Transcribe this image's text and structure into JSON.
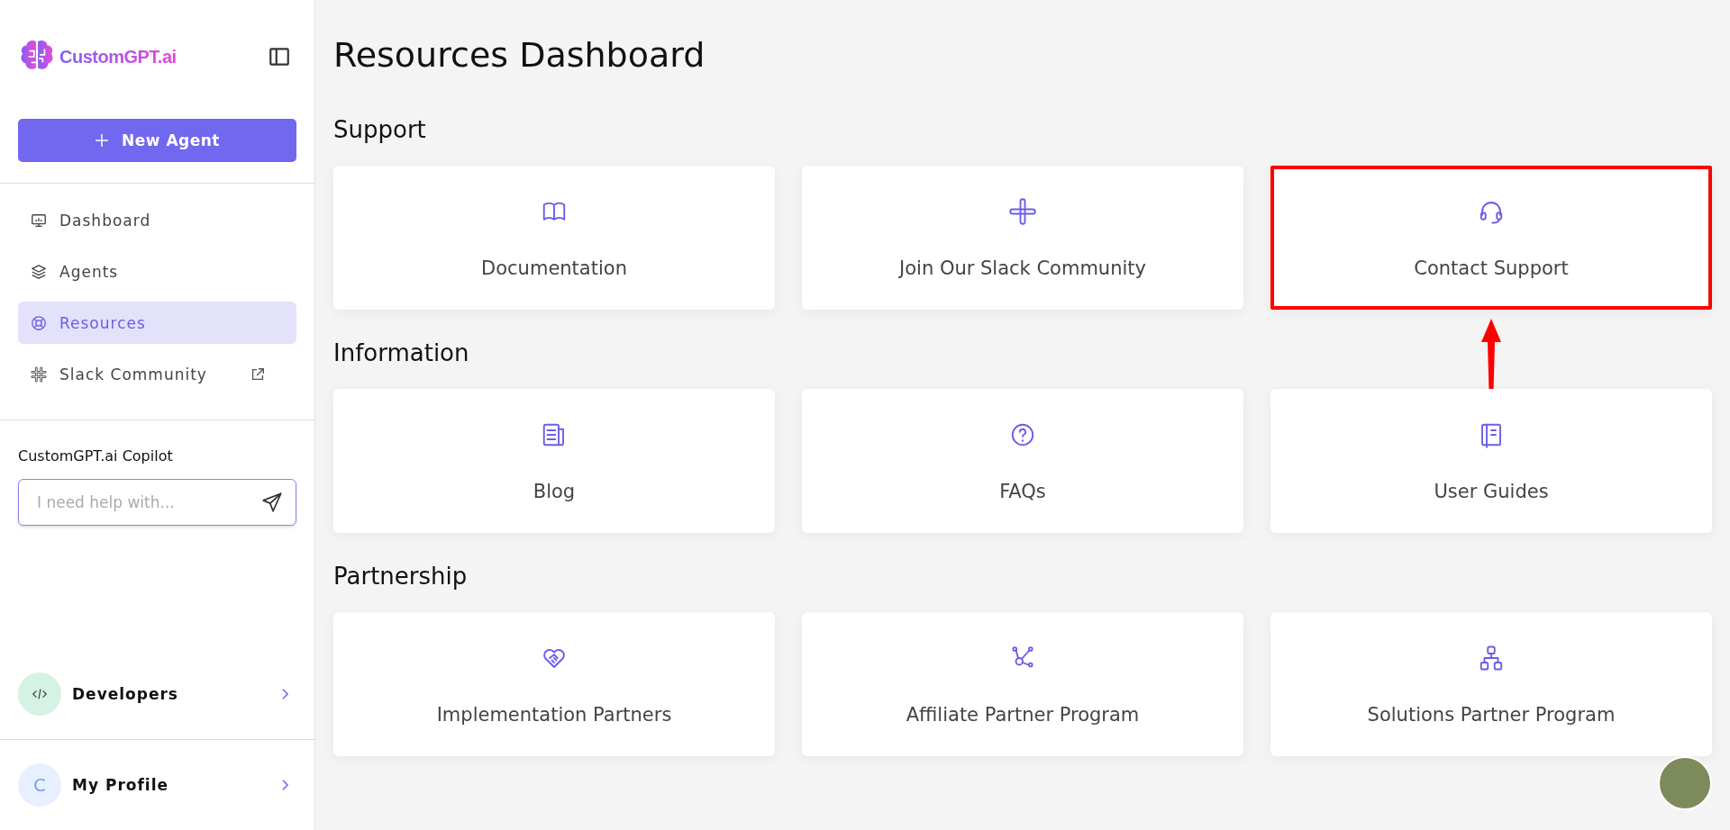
{
  "sidebar": {
    "logo": "CustomGPT.ai",
    "new_button": "New Agent",
    "nav": [
      {
        "label": "Dashboard",
        "selected": false,
        "external": false
      },
      {
        "label": "Agents",
        "selected": false,
        "external": false
      },
      {
        "label": "Resources",
        "selected": true,
        "external": false
      },
      {
        "label": "Slack Community",
        "selected": false,
        "external": true
      }
    ],
    "copilot": {
      "title": "CustomGPT.ai Copilot",
      "placeholder": "I need help with..."
    },
    "footer": [
      {
        "kind": "developers",
        "label": "Developers"
      },
      {
        "kind": "profile",
        "label": "My Profile",
        "initial": "C"
      }
    ]
  },
  "main": {
    "title": "Resources Dashboard",
    "sections": [
      {
        "title": "Support",
        "cards": [
          {
            "label": "Documentation",
            "highlighted": false
          },
          {
            "label": "Join Our Slack Community",
            "highlighted": false
          },
          {
            "label": "Contact Support",
            "highlighted": true
          }
        ]
      },
      {
        "title": "Information",
        "cards": [
          {
            "label": "Blog",
            "highlighted": false
          },
          {
            "label": "FAQs",
            "highlighted": false
          },
          {
            "label": "User Guides",
            "highlighted": false
          }
        ]
      },
      {
        "title": "Partnership",
        "cards": [
          {
            "label": "Implementation Partners",
            "highlighted": false
          },
          {
            "label": "Affiliate Partner Program",
            "highlighted": false
          },
          {
            "label": "Solutions Partner Program",
            "highlighted": false
          }
        ]
      }
    ]
  }
}
